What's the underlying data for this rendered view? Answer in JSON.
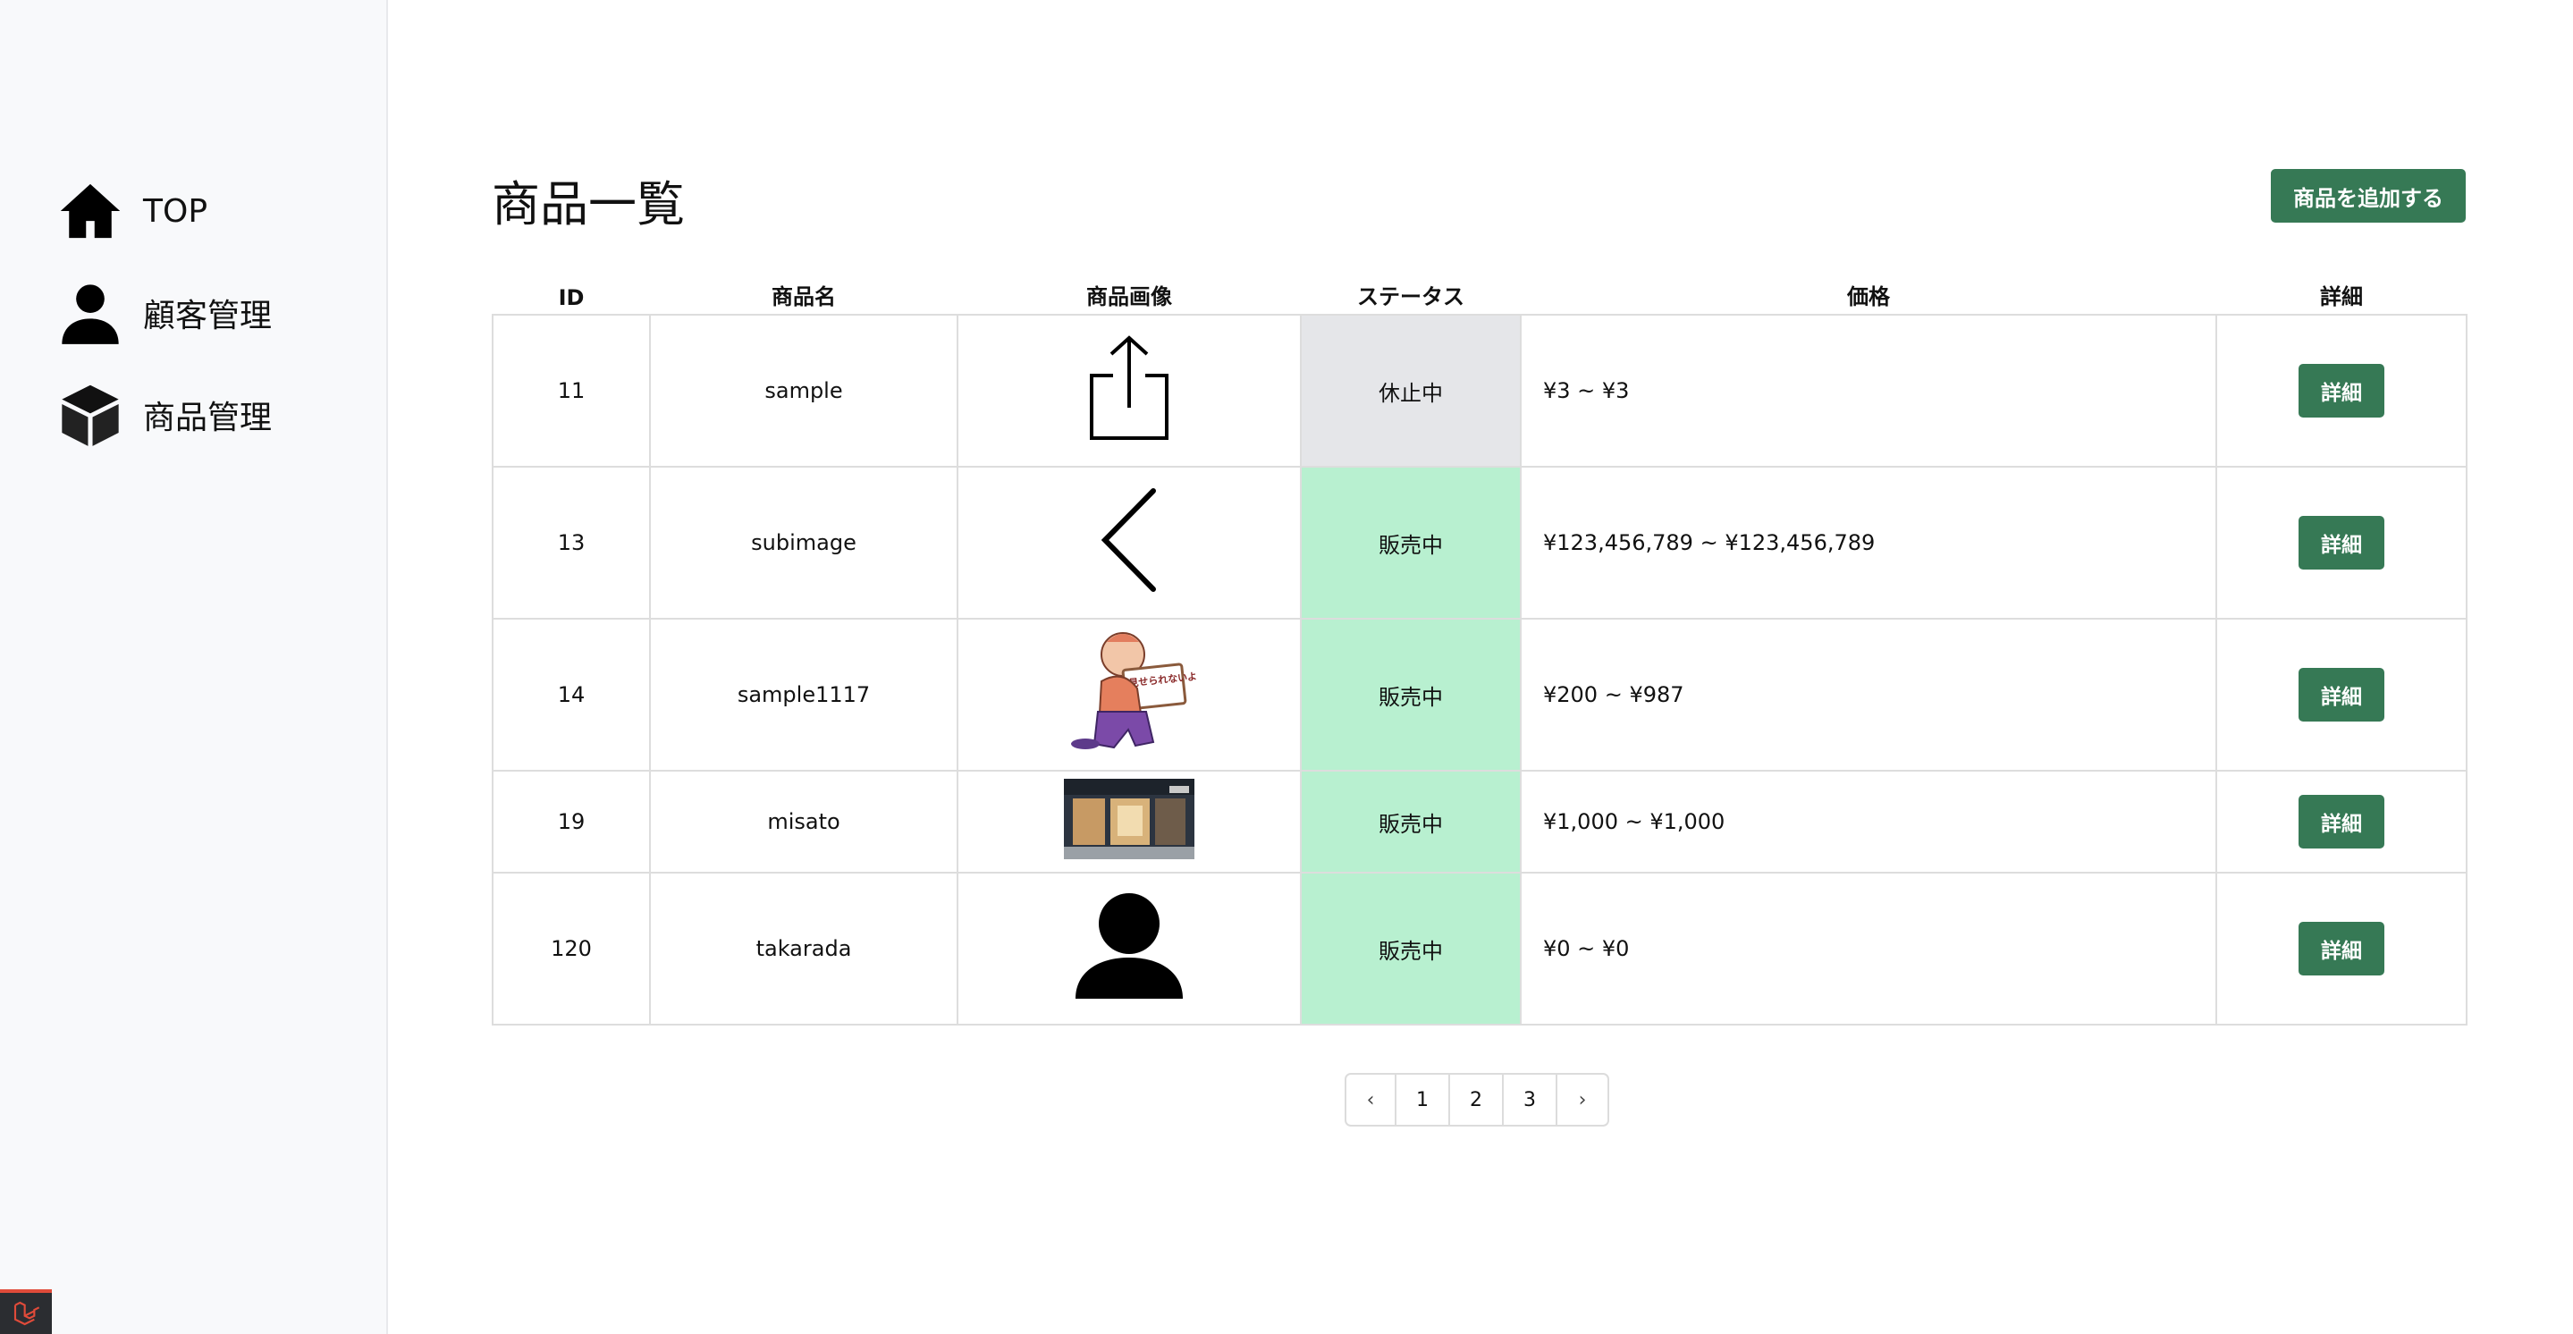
{
  "sidebar": {
    "items": [
      {
        "label": "TOP",
        "icon": "home-icon"
      },
      {
        "label": "顧客管理",
        "icon": "user-icon"
      },
      {
        "label": "商品管理",
        "icon": "box-icon"
      }
    ],
    "corner_logo": "laravel-logo-icon"
  },
  "main": {
    "title": "商品一覧",
    "add_button": "商品を追加する"
  },
  "table": {
    "headers": {
      "id": "ID",
      "name": "商品名",
      "image": "商品画像",
      "status": "ステータス",
      "price": "価格",
      "detail": "詳細"
    },
    "rows": [
      {
        "id": "11",
        "name": "sample",
        "image": "share-upload-icon",
        "status": "休止中",
        "price": "¥3 ~ ¥3",
        "detail": "詳細"
      },
      {
        "id": "13",
        "name": "subimage",
        "image": "chevron-left-icon",
        "status": "販売中",
        "price": "¥123,456,789 ~ ¥123,456,789",
        "detail": "詳細"
      },
      {
        "id": "14",
        "name": "sample1117",
        "image": "character-sign-image",
        "sign_text": "見せられないよ！",
        "status": "販売中",
        "price": "¥200 ~ ¥987",
        "detail": "詳細"
      },
      {
        "id": "19",
        "name": "misato",
        "image": "storefront-photo",
        "status": "販売中",
        "price": "¥1,000 ~ ¥1,000",
        "detail": "詳細"
      },
      {
        "id": "120",
        "name": "takarada",
        "image": "person-silhouette-icon",
        "status": "販売中",
        "price": "¥0 ~ ¥0",
        "detail": "詳細"
      }
    ]
  },
  "pagination": {
    "prev": "‹",
    "pages": [
      "1",
      "2",
      "3"
    ],
    "next": "›"
  },
  "colors": {
    "accent_button": "#367955",
    "status_sale_bg": "#b8f0d0",
    "status_paused_bg": "#e5e6e9",
    "sidebar_bg": "#f8f9fb"
  }
}
